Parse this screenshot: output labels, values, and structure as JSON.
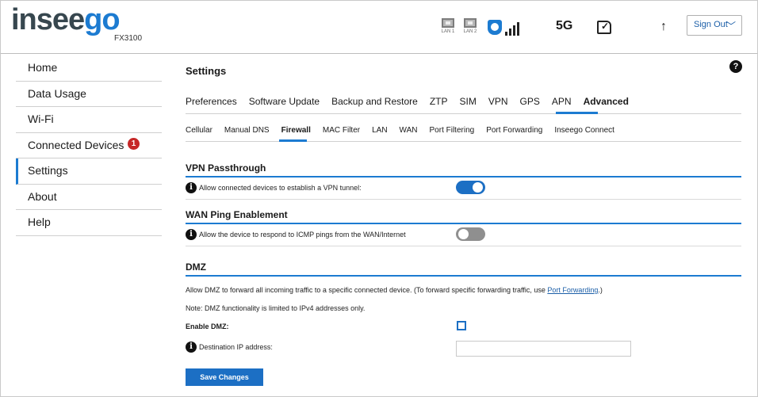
{
  "header": {
    "logo_part1": "insee",
    "logo_part2": "go",
    "model": "FX3100",
    "lan1_label": "LAN 1",
    "lan2_label": "LAN 2",
    "network_type": "5G",
    "upload_icon": "arrow-up-icon",
    "sign_out_label": "Sign Out",
    "accent_color": "#1c7bd1"
  },
  "sidebar": {
    "items": [
      {
        "label": "Home"
      },
      {
        "label": "Data Usage"
      },
      {
        "label": "Wi-Fi"
      },
      {
        "label": "Connected Devices",
        "badge": "1"
      },
      {
        "label": "Settings",
        "active": true
      },
      {
        "label": "About"
      },
      {
        "label": "Help"
      }
    ]
  },
  "main": {
    "title": "Settings",
    "help_glyph": "?",
    "tabs": [
      "Preferences",
      "Software Update",
      "Backup and Restore",
      "ZTP",
      "SIM",
      "VPN",
      "GPS",
      "APN",
      "Advanced"
    ],
    "active_tab": "Advanced",
    "subtabs": [
      "Cellular",
      "Manual DNS",
      "Firewall",
      "MAC Filter",
      "LAN",
      "WAN",
      "Port Filtering",
      "Port Forwarding",
      "Inseego Connect"
    ],
    "active_subtab": "Firewall",
    "vpn": {
      "title": "VPN Passthrough",
      "label": "Allow connected devices to establish a VPN tunnel:",
      "enabled": true
    },
    "wan_ping": {
      "title": "WAN Ping Enablement",
      "label": "Allow the device to respond to ICMP pings from the WAN/Internet",
      "enabled": false
    },
    "dmz": {
      "title": "DMZ",
      "description": "Allow DMZ to forward all incoming traffic to a specific connected device. (To forward specific forwarding traffic, use ",
      "link": "Port Forwarding",
      "description_end": ".)",
      "note": "Note: DMZ functionality is limited to IPv4 addresses only.",
      "enable_label": "Enable DMZ:",
      "enabled": false,
      "ip_label": "Destination IP address:",
      "ip_value": ""
    },
    "save_label": "Save Changes"
  }
}
